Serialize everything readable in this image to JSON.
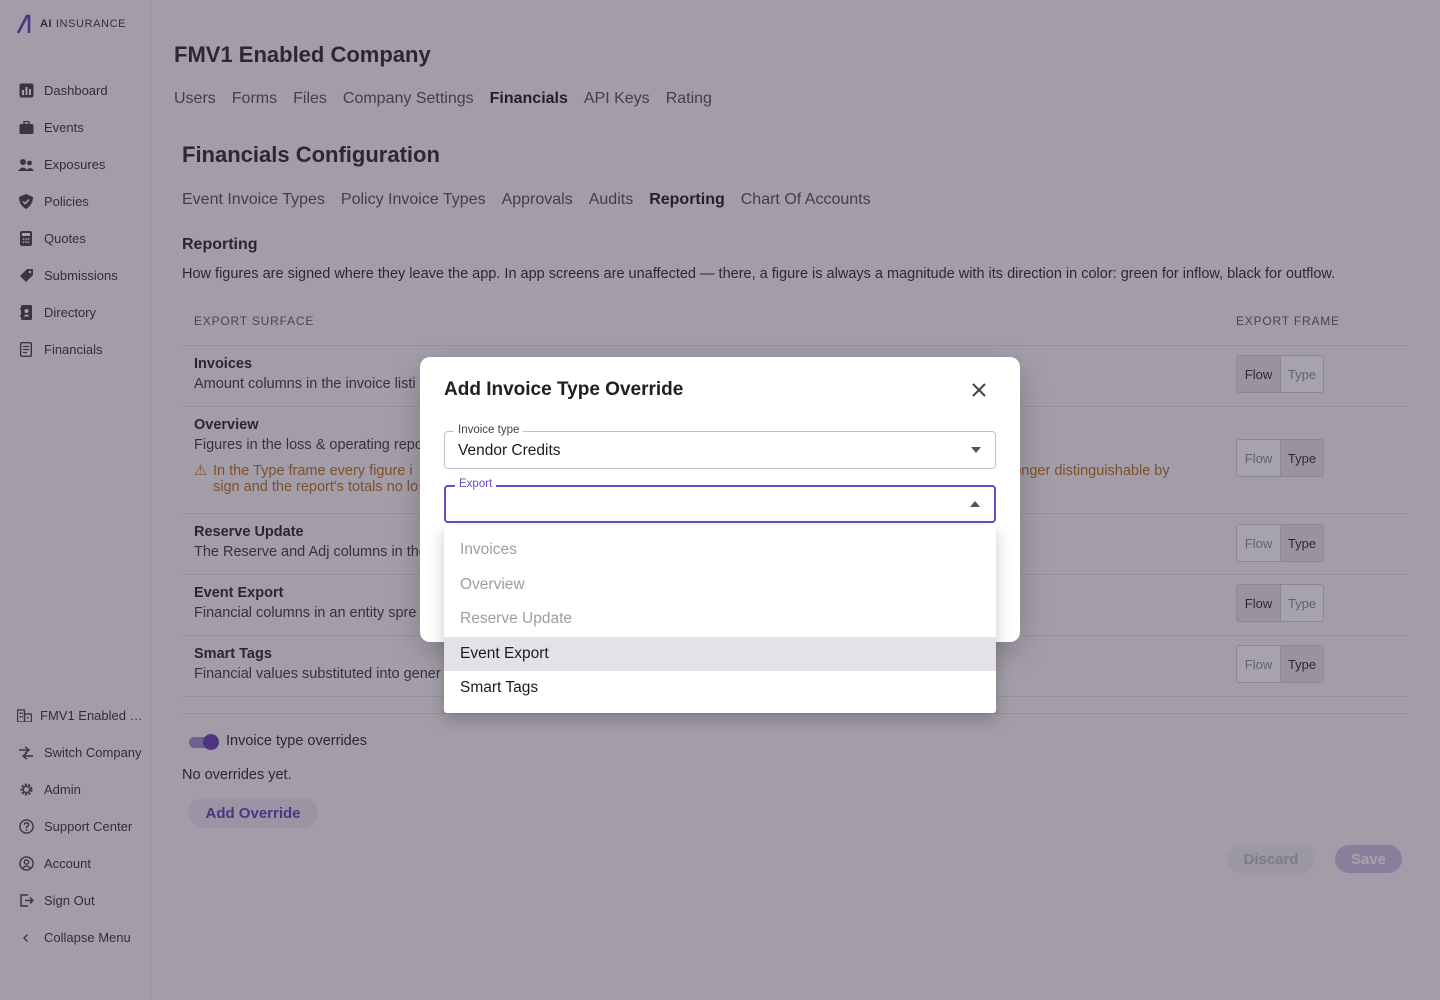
{
  "brand": {
    "name_bold": "AI",
    "name_rest": " INSURANCE",
    "accent": "#5c35b3"
  },
  "sidebar": {
    "items": [
      {
        "label": "Dashboard",
        "icon": "bar-chart-icon"
      },
      {
        "label": "Events",
        "icon": "briefcase-icon"
      },
      {
        "label": "Exposures",
        "icon": "people-icon"
      },
      {
        "label": "Policies",
        "icon": "shield-icon"
      },
      {
        "label": "Quotes",
        "icon": "calculator-icon"
      },
      {
        "label": "Submissions",
        "icon": "tag-icon"
      },
      {
        "label": "Directory",
        "icon": "address-book-icon"
      },
      {
        "label": "Financials",
        "icon": "receipt-icon"
      }
    ],
    "bottom": [
      {
        "label": "FMV1 Enabled …",
        "icon": "building-icon"
      },
      {
        "label": "Switch Company",
        "icon": "swap-icon"
      },
      {
        "label": "Admin",
        "icon": "gear-icon"
      },
      {
        "label": "Support Center",
        "icon": "help-icon"
      },
      {
        "label": "Account",
        "icon": "account-icon"
      },
      {
        "label": "Sign Out",
        "icon": "sign-out-icon"
      },
      {
        "label": "Collapse Menu",
        "icon": "chevron-left-icon"
      }
    ]
  },
  "header": {
    "company": "FMV1 Enabled Company",
    "tabs": [
      "Users",
      "Forms",
      "Files",
      "Company Settings",
      "Financials",
      "API Keys",
      "Rating"
    ],
    "active_tab": "Financials"
  },
  "financials": {
    "title": "Financials Configuration",
    "tabs": [
      "Event Invoice Types",
      "Policy Invoice Types",
      "Approvals",
      "Audits",
      "Reporting",
      "Chart Of Accounts"
    ],
    "active_tab": "Reporting"
  },
  "reporting": {
    "heading": "Reporting",
    "description": "How figures are signed where they leave the app. In app screens are unaffected — there, a figure is always a magnitude with its direction in color: green for inflow, black for outflow.",
    "columns": {
      "surface": "EXPORT SURFACE",
      "frame": "EXPORT FRAME"
    },
    "rows": [
      {
        "name": "Invoices",
        "desc": "Amount columns in the invoice listi",
        "selected": "Flow"
      },
      {
        "name": "Overview",
        "desc": "Figures in the loss & operating repo",
        "selected": "Type",
        "warning_left": "In the Type frame every figure i",
        "warning_right": "longer distinguishable by",
        "warning_line2": "sign and the report's totals no lo"
      },
      {
        "name": "Reserve Update",
        "desc": "The Reserve and Adj columns in the",
        "selected": "Type"
      },
      {
        "name": "Event Export",
        "desc": "Financial columns in an entity spre",
        "selected": "Flow"
      },
      {
        "name": "Smart Tags",
        "desc": "Financial values substituted into gener",
        "selected": "Type"
      }
    ],
    "frame_options": [
      "Flow",
      "Type"
    ]
  },
  "overrides": {
    "toggle_label": "Invoice type overrides",
    "toggle_on": true,
    "empty_text": "No overrides yet.",
    "add_label": "Add Override"
  },
  "footer": {
    "discard_label": "Discard",
    "save_label": "Save"
  },
  "modal": {
    "title": "Add Invoice Type Override",
    "invoice_type": {
      "label": "Invoice type",
      "value": "Vendor Credits"
    },
    "export": {
      "label": "Export",
      "value": ""
    },
    "options": [
      {
        "label": "Invoices",
        "disabled": true
      },
      {
        "label": "Overview",
        "disabled": true
      },
      {
        "label": "Reserve Update",
        "disabled": true
      },
      {
        "label": "Event Export",
        "disabled": false,
        "hover": true
      },
      {
        "label": "Smart Tags",
        "disabled": false
      }
    ]
  }
}
